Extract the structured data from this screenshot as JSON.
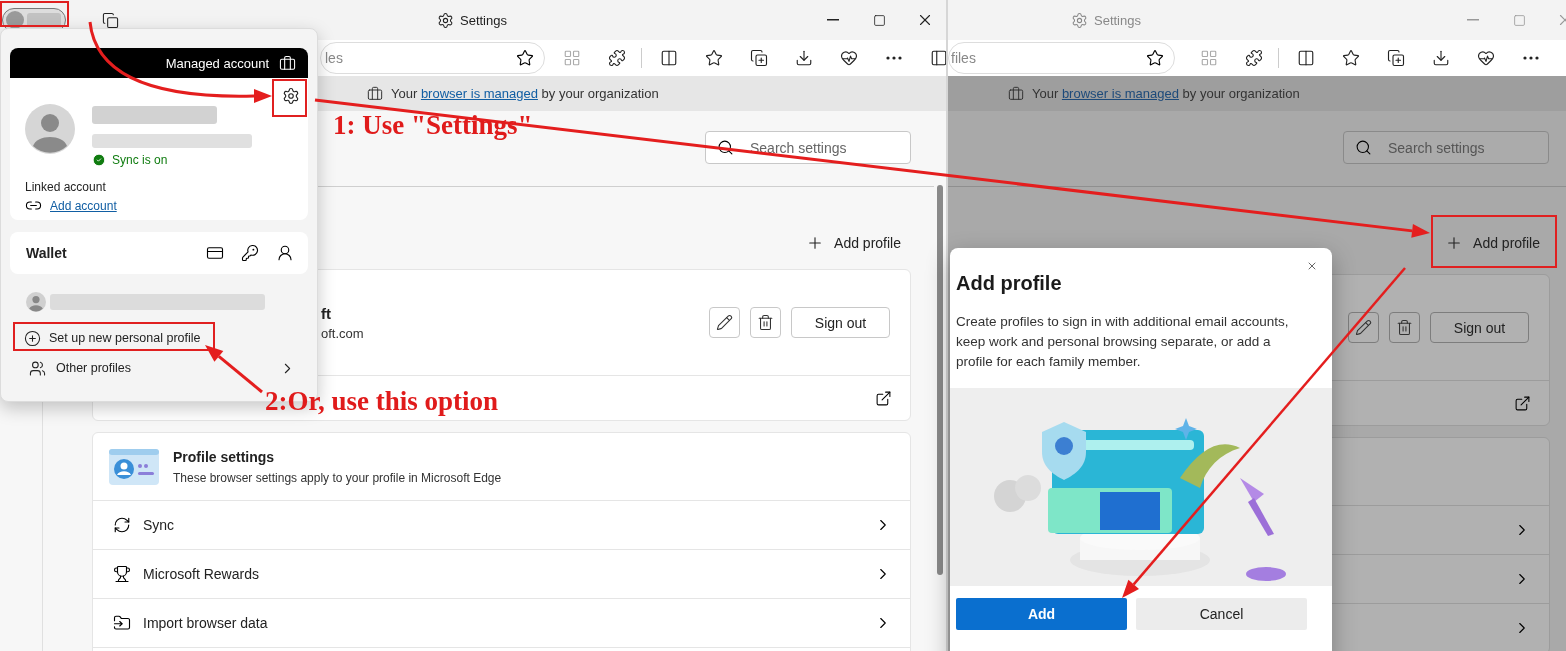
{
  "left_window": {
    "title": "Settings",
    "address": "les",
    "banner": {
      "prefix": "Your ",
      "link": "browser is managed",
      "suffix": " by your organization"
    },
    "search": {
      "placeholder": "Search settings"
    },
    "add_profile": "Add profile",
    "profile": {
      "name": "ft",
      "email": "oft.com",
      "sign_out": "Sign out"
    },
    "profile_settings": {
      "title": "Profile settings",
      "description": "These browser settings apply to your profile in Microsoft Edge",
      "rows": [
        {
          "label": "Sync"
        },
        {
          "label": "Microsoft Rewards"
        },
        {
          "label": "Import browser data"
        }
      ]
    }
  },
  "right_window": {
    "title": "Settings",
    "address": "files",
    "banner": {
      "prefix": "Your ",
      "link": "browser is managed",
      "suffix": " by your organization"
    },
    "search": {
      "placeholder": "Search settings"
    },
    "add_profile": "Add profile",
    "profile": {
      "sign_out": "Sign out"
    }
  },
  "profile_flyout": {
    "header": "Managed account",
    "sync_status": "Sync is on",
    "linked_account_label": "Linked account",
    "add_account": "Add account",
    "wallet": "Wallet",
    "actions": [
      {
        "label": "Set up new personal profile"
      },
      {
        "label": "Other profiles"
      }
    ]
  },
  "dialog": {
    "title": "Add profile",
    "description": "Create profiles to sign in with additional email accounts, keep work and personal browsing separate, or add a profile for each family member.",
    "buttons": [
      {
        "label": "Add",
        "kind": "primary"
      },
      {
        "label": "Cancel",
        "kind": "secondary"
      }
    ]
  },
  "annotations": [
    {
      "text": "1: Use \"Settings\""
    },
    {
      "text": "2:Or, use this option"
    }
  ]
}
